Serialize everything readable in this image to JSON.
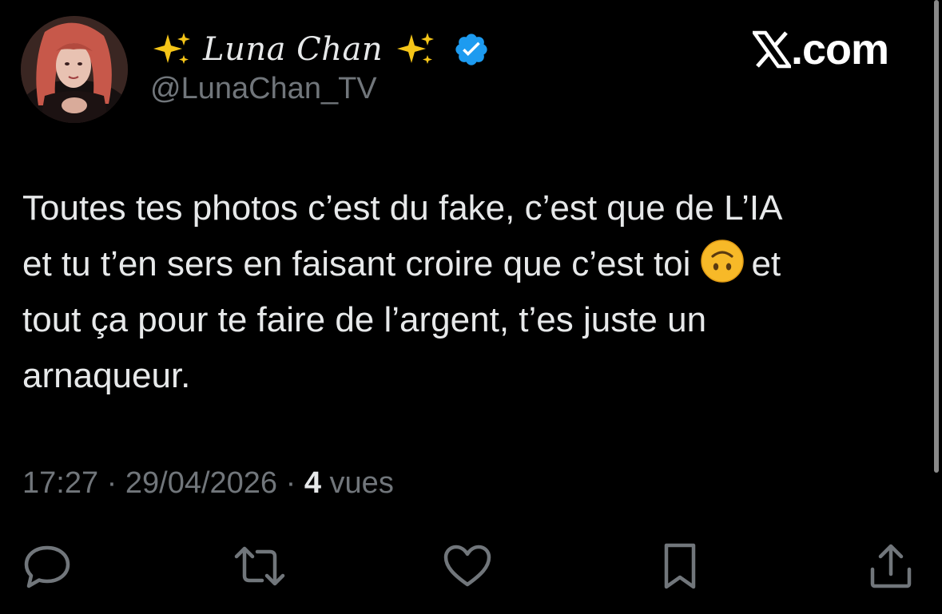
{
  "author": {
    "display_name": "Luna Chan",
    "handle": "@LunaChan_TV",
    "verified": true,
    "name_decoration_icon": "sparkles-icon"
  },
  "brand": {
    "text": ".com",
    "logo_icon": "x-logo-icon"
  },
  "tweet": {
    "line1": "Toutes tes photos c’est du fake, c’est que de L’IA",
    "line2a": "et tu t’en sers en faisant croire que c’est toi",
    "emoji": "upside-down-face-emoji",
    "line2b": "et",
    "line3": "tout ça pour te faire de l’argent, t’es juste un",
    "line4": "arnaqueur."
  },
  "meta": {
    "time": "17:27",
    "separator": "·",
    "date": "29/04/2026",
    "views_count": "4",
    "views_label": "vues"
  },
  "actions": [
    {
      "name": "reply-button",
      "icon": "reply-icon"
    },
    {
      "name": "repost-button",
      "icon": "repost-icon"
    },
    {
      "name": "like-button",
      "icon": "heart-icon"
    },
    {
      "name": "bookmark-button",
      "icon": "bookmark-icon"
    },
    {
      "name": "share-button",
      "icon": "share-icon"
    }
  ],
  "colors": {
    "background": "#000000",
    "primary_text": "#e7e9ea",
    "secondary_text": "#71767b",
    "verified_badge": "#1d9bf0"
  }
}
